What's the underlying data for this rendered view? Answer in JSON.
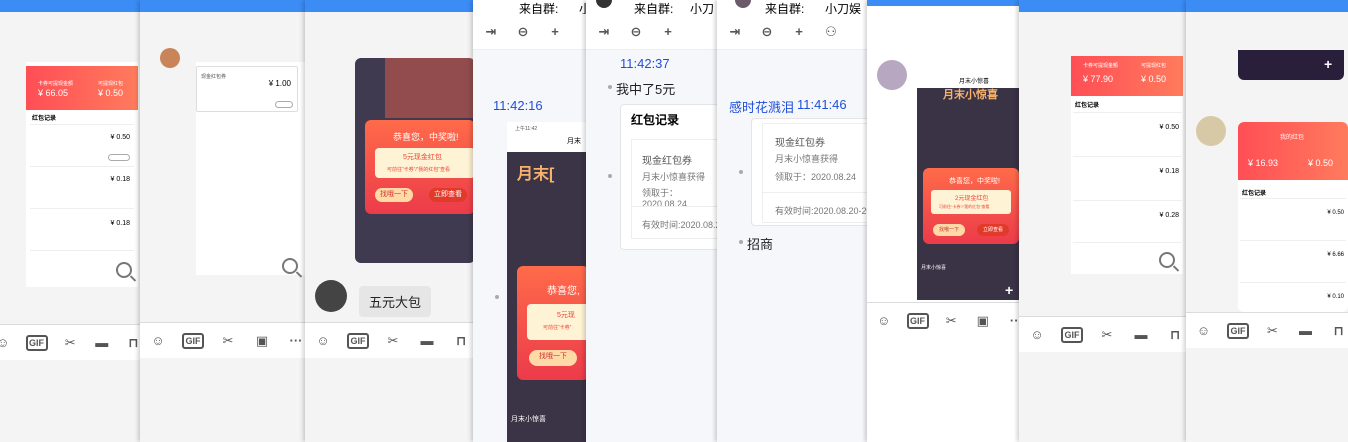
{
  "icons": {
    "emoji": "emoji-icon",
    "gif": "GIF",
    "scissors": "scissors-icon",
    "image": "image-icon",
    "folder": "folder-icon",
    "more": "more-icon",
    "share": "share-icon",
    "zoom": "zoom-icon"
  },
  "p1": {
    "title": "卡券可提现金额",
    "title2": "可提现红包",
    "amount": "¥ 66.05",
    "amount2": "¥ 0.50",
    "section": "红包记录",
    "v1": "¥ 0.50",
    "v2": "¥ 0.18",
    "v3": "¥ 0.18"
  },
  "p2": {
    "card_title": "现金红包券",
    "value": "¥ 1.00"
  },
  "p3": {
    "winner": "恭喜您，中奖啦!",
    "prize": "5元现金红包",
    "sub": "可前往“卡券”/“我的红包”查看",
    "btn_a": "找哦一下",
    "btn_b": "立即查看",
    "message": "五元大包"
  },
  "p4": {
    "source_label": "来自群:",
    "source_name": "小",
    "time": "11:42:16",
    "status_time": "上午11:42",
    "header": "月末",
    "banner": "月末[",
    "winner": "恭喜您,",
    "prize": "5元现",
    "sub": "可前往“卡券”",
    "btn": "找哦一下",
    "footer": "月末小惊喜"
  },
  "p5": {
    "source_label": "来自群:",
    "source_name": "小刀",
    "time": "11:42:37",
    "message": "我中了5元",
    "card_title": "红包记录",
    "coupon": "现金红包券",
    "from": "月末小惊喜获得",
    "date": "领取于：2020.08.24",
    "valid": "有效时间:2020.08.2"
  },
  "p6": {
    "source_label": "来自群:",
    "source_name": "小刀娱乐",
    "sender": "感时花溅泪",
    "time": "11:41:46",
    "coupon": "现金红包券",
    "from": "月末小惊喜获得",
    "date": "领取于：2020.08.24",
    "valid": "有效时间:2020.08.20-20",
    "message": "招商"
  },
  "p7": {
    "title": "月末小惊喜",
    "banner": "月末小惊喜",
    "winner": "恭喜您，中奖啦!",
    "prize": "2元现金红包",
    "sub": "可前往“卡券”/“我的红包”查看",
    "btn_a": "找哦一下",
    "btn_b": "立即查看",
    "footer": "月末小惊喜"
  },
  "p8": {
    "title": "卡券可提现金额",
    "title2": "可提现红包",
    "amount": "¥ 77.90",
    "amount2": "¥ 0.50",
    "section": "红包记录",
    "v1": "¥ 0.50",
    "v2": "¥ 0.18",
    "v3": "¥ 0.28"
  },
  "p9": {
    "title": "我的红包",
    "amount": "¥ 16.93",
    "amount2": "¥ 0.50",
    "section": "红包记录",
    "v1": "¥ 0.50",
    "v2": "¥ 6.66",
    "v3": "¥ 0.10"
  }
}
